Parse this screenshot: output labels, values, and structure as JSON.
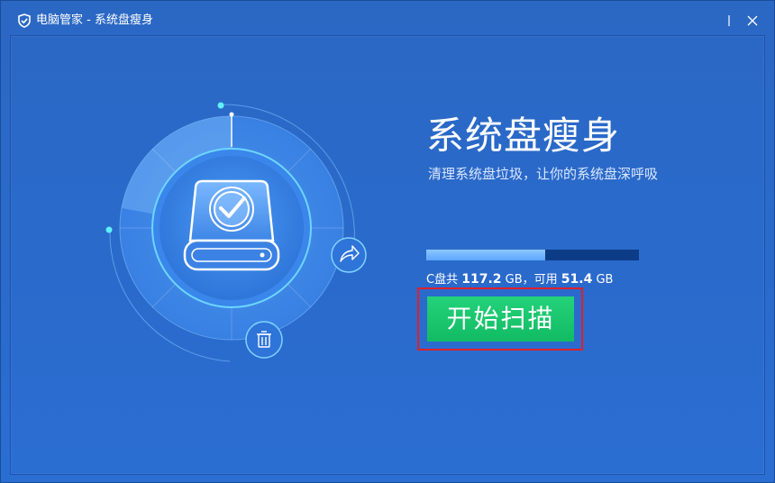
{
  "window": {
    "title": "电脑管家 - 系统盘瘦身",
    "logo_icon": "tencent-shield-icon"
  },
  "controls": {
    "minimize_icon": "minimize-icon",
    "close_icon": "close-icon"
  },
  "graphic": {
    "center_icon": "disk-check-icon",
    "share_icon": "share-arrow-icon",
    "trash_icon": "trash-icon"
  },
  "main": {
    "headline": "系统盘瘦身",
    "subtitle": "清理系统盘垃圾，让你的系统盘深呼吸",
    "usage_fraction": 0.56,
    "disk_info": {
      "label": "C盘共",
      "total": "117.2",
      "unit1": " GB，可用 ",
      "free": "51.4",
      "unit2": " GB"
    },
    "scan_button": "开始扫描"
  },
  "colors": {
    "background": "#2a6acb",
    "accent_green": "#16c46b",
    "highlight_red": "#e0202a",
    "bar_track": "#0d3c86",
    "bar_fill": "#6fb2ff"
  }
}
